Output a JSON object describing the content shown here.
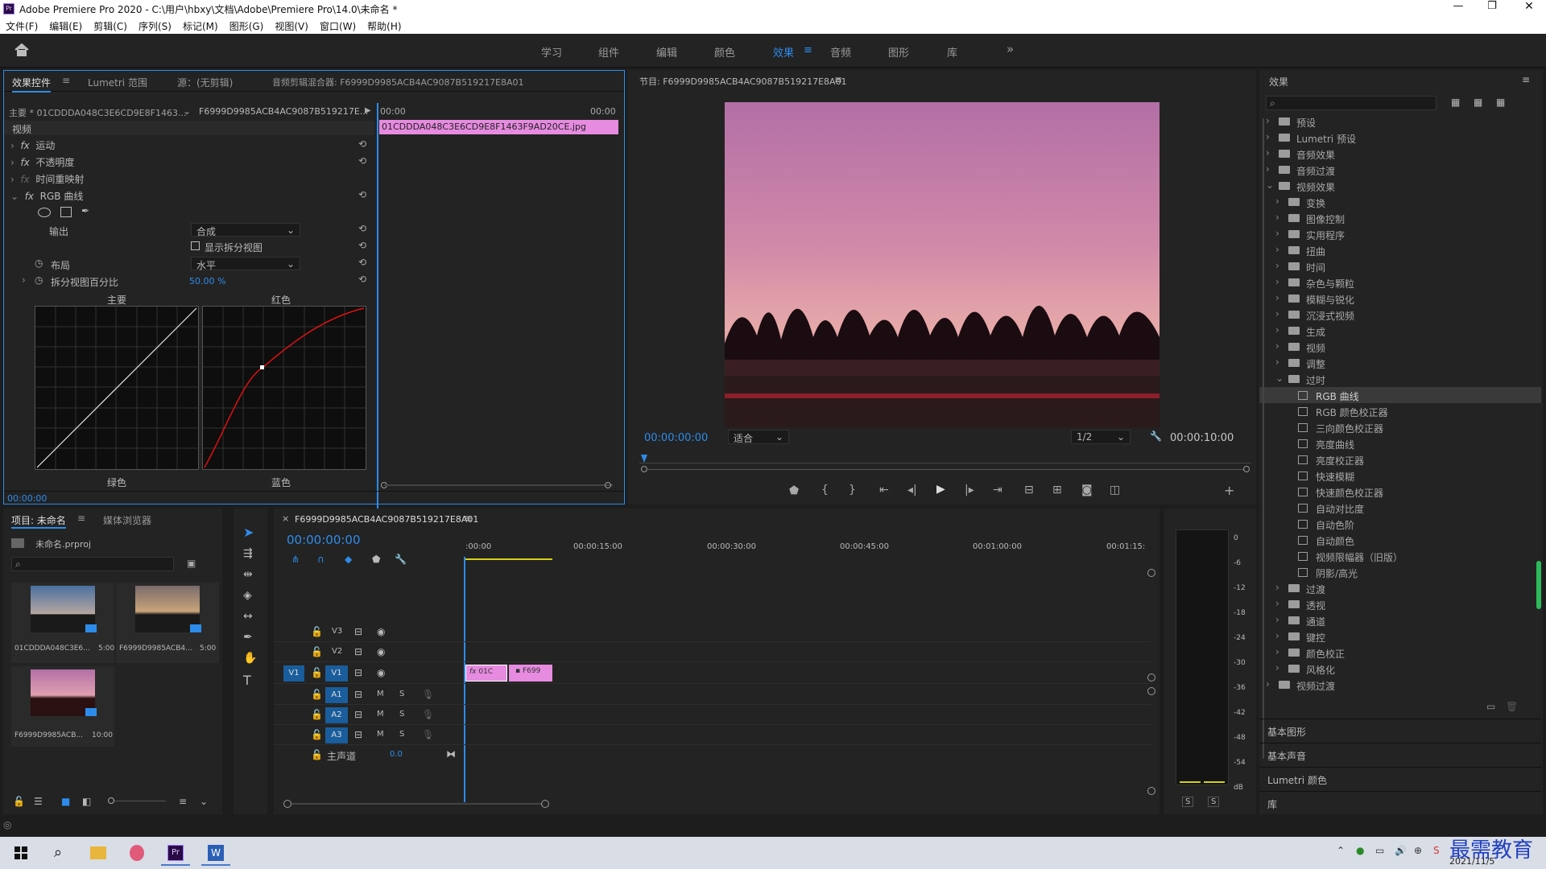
{
  "title": "Adobe Premiere Pro 2020 - C:\\用户\\hbxy\\文档\\Adobe\\Premiere Pro\\14.0\\未命名 *",
  "menu": [
    "文件(F)",
    "编辑(E)",
    "剪辑(C)",
    "序列(S)",
    "标记(M)",
    "图形(G)",
    "视图(V)",
    "窗口(W)",
    "帮助(H)"
  ],
  "workspaces": [
    "学习",
    "组件",
    "编辑",
    "颜色",
    "效果",
    "音频",
    "图形",
    "库"
  ],
  "ec": {
    "tabs": [
      "效果控件",
      "Lumetri 范围",
      "源：(无剪辑)",
      "音频剪辑混合器: F6999D9985ACB4AC9087B519217E8A01"
    ],
    "master": "主要 * 01CDDDA048C3E6CD9E8F1463...",
    "seq": "F6999D9985ACB4AC9087B519217E...",
    "t_start": "00:00",
    "t_end": "00:00",
    "clip": "01CDDDA048C3E6CD9E8F1463F9AD20CE.jpg",
    "video_label": "视频",
    "props": [
      "运动",
      "不透明度",
      "时间重映射",
      "RGB 曲线"
    ],
    "output_label": "输出",
    "output_value": "合成",
    "split_view": "显示拆分视图",
    "layout_label": "布局",
    "layout_value": "水平",
    "split_pct_label": "拆分视图百分比",
    "split_pct": "50.00 %",
    "curve_labels": [
      "主要",
      "红色",
      "绿色",
      "蓝色"
    ],
    "timecode": "00:00:00"
  },
  "program": {
    "title": "节目: F6999D9985ACB4AC9087B519217E8A01",
    "tc_left": "00:00:00:00",
    "fit": "适合",
    "res": "1/2",
    "tc_right": "00:00:10:00"
  },
  "project": {
    "tabs": [
      "项目: 未命名",
      "媒体浏览器"
    ],
    "file": "未命名.prproj",
    "items": [
      {
        "name": "01CDDDA048C3E6...",
        "dur": "5:00"
      },
      {
        "name": "F6999D9985ACB4...",
        "dur": "5:00"
      },
      {
        "name": "F6999D9985ACB...",
        "dur": "10:00"
      }
    ]
  },
  "timeline": {
    "tab": "F6999D9985ACB4AC9087B519217E8A01",
    "tc": "00:00:00:00",
    "ruler": [
      ":00:00",
      "00:00:15:00",
      "00:00:30:00",
      "00:00:45:00",
      "00:01:00:00",
      "00:01:15:"
    ],
    "tracks_v": [
      "V3",
      "V2",
      "V1"
    ],
    "tracks_a": [
      "A1",
      "A2",
      "A3"
    ],
    "src_v": "V1",
    "mix_label": "主声道",
    "mix_val": "0.0",
    "clip1": "01C",
    "clip2": "F699",
    "ms": [
      "M",
      "S"
    ]
  },
  "meter": {
    "scale": [
      "0",
      "-6",
      "-12",
      "-18",
      "-24",
      "-30",
      "-36",
      "-42",
      "-48",
      "-54",
      "dB"
    ],
    "s": [
      "S",
      "S"
    ]
  },
  "effects": {
    "title": "效果",
    "tree": [
      {
        "label": "预设",
        "indent": 0,
        "icon": "star-folder"
      },
      {
        "label": "Lumetri 预设",
        "indent": 0,
        "icon": "star-folder"
      },
      {
        "label": "音频效果",
        "indent": 0,
        "icon": "folder"
      },
      {
        "label": "音频过渡",
        "indent": 0,
        "icon": "folder"
      },
      {
        "label": "视频效果",
        "indent": 0,
        "icon": "folder",
        "open": true
      },
      {
        "label": "变换",
        "indent": 1,
        "icon": "folder"
      },
      {
        "label": "图像控制",
        "indent": 1,
        "icon": "folder"
      },
      {
        "label": "实用程序",
        "indent": 1,
        "icon": "folder"
      },
      {
        "label": "扭曲",
        "indent": 1,
        "icon": "folder"
      },
      {
        "label": "时间",
        "indent": 1,
        "icon": "folder"
      },
      {
        "label": "杂色与颗粒",
        "indent": 1,
        "icon": "folder"
      },
      {
        "label": "模糊与锐化",
        "indent": 1,
        "icon": "folder"
      },
      {
        "label": "沉浸式视频",
        "indent": 1,
        "icon": "folder"
      },
      {
        "label": "生成",
        "indent": 1,
        "icon": "folder"
      },
      {
        "label": "视频",
        "indent": 1,
        "icon": "folder"
      },
      {
        "label": "调整",
        "indent": 1,
        "icon": "folder"
      },
      {
        "label": "过时",
        "indent": 1,
        "icon": "folder",
        "open": true
      },
      {
        "label": "RGB 曲线",
        "indent": 2,
        "icon": "fx",
        "selected": true
      },
      {
        "label": "RGB 颜色校正器",
        "indent": 2,
        "icon": "fx"
      },
      {
        "label": "三向颜色校正器",
        "indent": 2,
        "icon": "fx"
      },
      {
        "label": "亮度曲线",
        "indent": 2,
        "icon": "fx"
      },
      {
        "label": "亮度校正器",
        "indent": 2,
        "icon": "fx"
      },
      {
        "label": "快速模糊",
        "indent": 2,
        "icon": "fx"
      },
      {
        "label": "快速颜色校正器",
        "indent": 2,
        "icon": "fx"
      },
      {
        "label": "自动对比度",
        "indent": 2,
        "icon": "fx"
      },
      {
        "label": "自动色阶",
        "indent": 2,
        "icon": "fx"
      },
      {
        "label": "自动颜色",
        "indent": 2,
        "icon": "fx"
      },
      {
        "label": "视频限幅器（旧版）",
        "indent": 2,
        "icon": "fx"
      },
      {
        "label": "阴影/高光",
        "indent": 2,
        "icon": "fx"
      },
      {
        "label": "过渡",
        "indent": 1,
        "icon": "folder"
      },
      {
        "label": "透视",
        "indent": 1,
        "icon": "folder"
      },
      {
        "label": "通道",
        "indent": 1,
        "icon": "folder"
      },
      {
        "label": "键控",
        "indent": 1,
        "icon": "folder"
      },
      {
        "label": "颜色校正",
        "indent": 1,
        "icon": "folder"
      },
      {
        "label": "风格化",
        "indent": 1,
        "icon": "folder"
      },
      {
        "label": "视频过渡",
        "indent": 0,
        "icon": "folder"
      }
    ],
    "sections": [
      "基本图形",
      "基本声音",
      "Lumetri 颜色",
      "库"
    ]
  },
  "taskbar": {
    "date": "2021/11/5",
    "brand": "最需教育"
  },
  "colors": {
    "accent": "#2d8ceb",
    "clip": "#e68be0",
    "bg": "#232323"
  }
}
